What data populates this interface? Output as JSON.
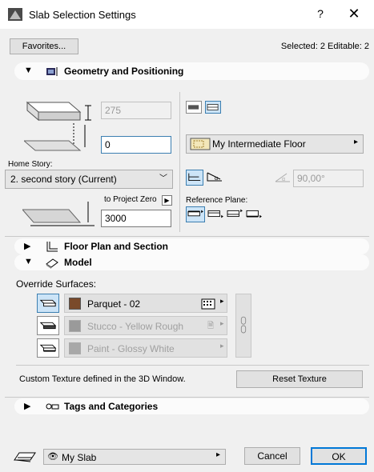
{
  "window": {
    "title": "Slab Selection Settings",
    "help": "?",
    "close": "✕"
  },
  "top": {
    "favorites": "Favorites...",
    "selected_info": "Selected: 2 Editable: 2"
  },
  "geometry": {
    "header": "Geometry and Positioning",
    "thickness_value": "275",
    "offset_value": "0",
    "home_story_label": "Home Story:",
    "home_story_value": "2. second story (Current)",
    "to_project_zero_label": "to Project Zero",
    "elevation_value": "3000",
    "layer_value": "My Intermediate Floor",
    "angle_value": "90,00°",
    "reference_plane_label": "Reference Plane:"
  },
  "floor_plan": {
    "header": "Floor Plan and Section"
  },
  "model": {
    "header": "Model",
    "override_label": "Override Surfaces:",
    "surfaces": [
      {
        "name": "Parquet - 02",
        "color": "#7a4a2a",
        "enabled": true
      },
      {
        "name": "Stucco - Yellow Rough",
        "color": "#9a9a9a",
        "enabled": false
      },
      {
        "name": "Paint - Glossy White",
        "color": "#a8a8a8",
        "enabled": false
      }
    ],
    "custom_texture_text": "Custom Texture defined in the 3D Window.",
    "reset_texture": "Reset Texture"
  },
  "tags": {
    "header": "Tags and Categories"
  },
  "footer": {
    "favorite_name": "My Slab",
    "cancel": "Cancel",
    "ok": "OK"
  },
  "colors": {
    "focus_border": "#3c7fb1",
    "selected_fill": "#cce4f7",
    "window_bg": "#f0f0f0"
  }
}
